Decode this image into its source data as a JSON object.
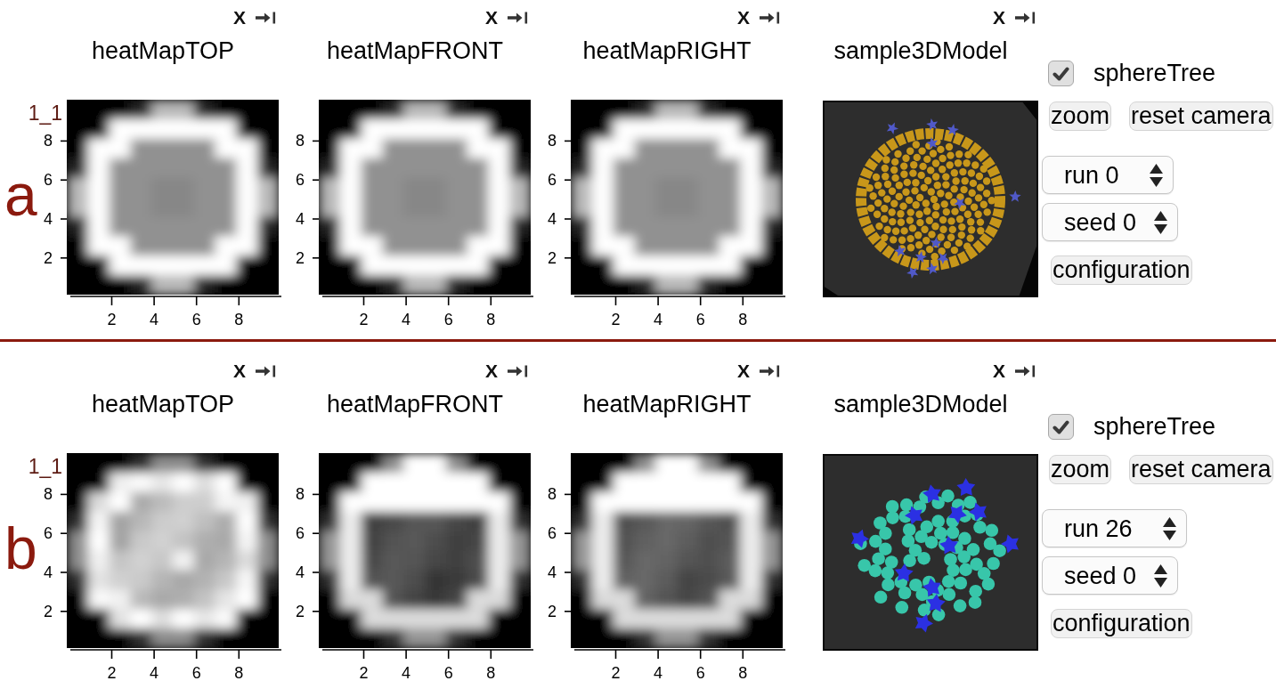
{
  "panels": [
    {
      "label": "a",
      "views": [
        {
          "kind": "heatmap",
          "close_label": "X",
          "title": "heatMapTOP",
          "corner_label": "1_1",
          "y_ticks": [
            "8",
            "6",
            "4",
            "2"
          ],
          "x_ticks": [
            "2",
            "4",
            "6",
            "8"
          ]
        },
        {
          "kind": "heatmap",
          "close_label": "X",
          "title": "heatMapFRONT",
          "y_ticks": [
            "8",
            "6",
            "4",
            "2"
          ],
          "x_ticks": [
            "2",
            "4",
            "6",
            "8"
          ]
        },
        {
          "kind": "heatmap",
          "close_label": "X",
          "title": "heatMapRIGHT",
          "y_ticks": [
            "8",
            "6",
            "4",
            "2"
          ],
          "x_ticks": [
            "2",
            "4",
            "6",
            "8"
          ]
        },
        {
          "kind": "model",
          "close_label": "X",
          "title": "sample3DModel"
        }
      ],
      "controls": {
        "checkbox": {
          "label": "sphereTree",
          "checked": true
        },
        "buttons": [
          "zoom",
          "reset camera"
        ],
        "selects": [
          "run 0",
          "seed 0"
        ],
        "action_button": "configuration"
      }
    },
    {
      "label": "b",
      "views": [
        {
          "kind": "heatmap",
          "close_label": "X",
          "title": "heatMapTOP",
          "corner_label": "1_1",
          "y_ticks": [
            "8",
            "6",
            "4",
            "2"
          ],
          "x_ticks": [
            "2",
            "4",
            "6",
            "8"
          ]
        },
        {
          "kind": "heatmap",
          "close_label": "X",
          "title": "heatMapFRONT",
          "y_ticks": [
            "8",
            "6",
            "4",
            "2"
          ],
          "x_ticks": [
            "2",
            "4",
            "6",
            "8"
          ]
        },
        {
          "kind": "heatmap",
          "close_label": "X",
          "title": "heatMapRIGHT",
          "y_ticks": [
            "8",
            "6",
            "4",
            "2"
          ],
          "x_ticks": [
            "2",
            "4",
            "6",
            "8"
          ]
        },
        {
          "kind": "model",
          "close_label": "X",
          "title": "sample3DModel"
        }
      ],
      "controls": {
        "checkbox": {
          "label": "sphereTree",
          "checked": true
        },
        "buttons": [
          "zoom",
          "reset camera"
        ],
        "selects": [
          "run 26",
          "seed 0"
        ],
        "action_button": "configuration"
      }
    }
  ]
}
